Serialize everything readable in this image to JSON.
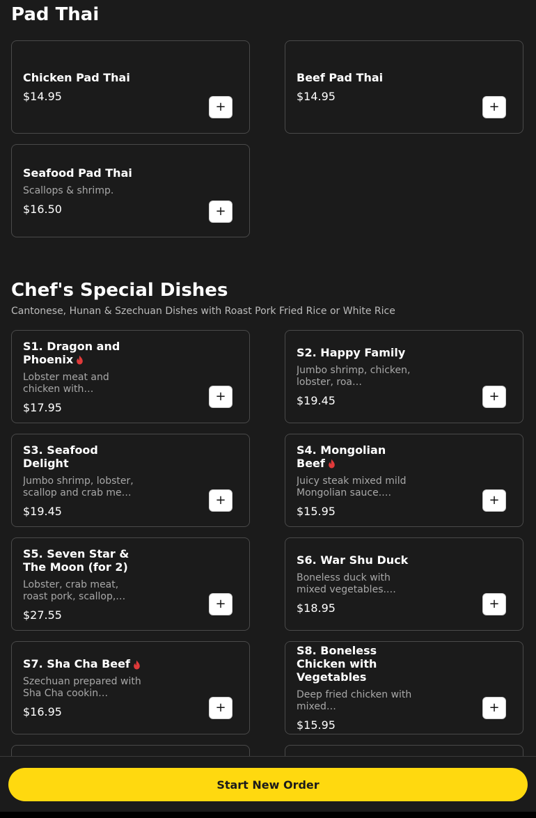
{
  "sections": [
    {
      "title": "Pad Thai",
      "items": [
        {
          "name": "Chicken Pad Thai",
          "price": "$14.95"
        },
        {
          "name": "Beef Pad Thai",
          "price": "$14.95"
        },
        {
          "name": "Seafood Pad Thai",
          "desc": "Scallops & shrimp.",
          "price": "$16.50"
        }
      ]
    },
    {
      "title": "Chef's Special Dishes",
      "subtitle": "Cantonese, Hunan & Szechuan Dishes with Roast Pork Fried Rice or White Rice",
      "items": [
        {
          "name": "S1. Dragon and Phoenix",
          "spicy": true,
          "desc": "Lobster meat and chicken with…",
          "price": "$17.95"
        },
        {
          "name": "S2. Happy Family",
          "desc": "Jumbo shrimp, chicken, lobster, roa…",
          "price": "$19.45"
        },
        {
          "name": "S3. Seafood Delight",
          "desc": "Jumbo shrimp, lobster, scallop and crab me…",
          "price": "$19.45"
        },
        {
          "name": "S4. Mongolian Beef",
          "spicy": true,
          "desc": "Juicy steak mixed mild Mongolian sauce.…",
          "price": "$15.95"
        },
        {
          "name": "S5. Seven Star & The Moon (for 2)",
          "desc": "Lobster, crab meat, roast pork, scallop,…",
          "price": "$27.55"
        },
        {
          "name": "S6. War Shu Duck",
          "desc": "Boneless duck with mixed vegetables.…",
          "price": "$18.95"
        },
        {
          "name": "S7. Sha Cha Beef",
          "spicy": true,
          "desc": "Szechuan prepared with Sha Cha cookin…",
          "price": "$16.95"
        },
        {
          "name": "S8. Boneless Chicken with Vegetables",
          "desc": "Deep fried chicken with mixed…",
          "price": "$15.95"
        }
      ]
    }
  ],
  "icons": {
    "add": "plus-icon",
    "spicy": "flame-icon"
  },
  "add_symbol": "+",
  "colors": {
    "background": "#1b1b1b",
    "accent": "#ffd90f",
    "spicy": "#e03a3a",
    "border": "#4a4a4a"
  },
  "footer": {
    "start_order_label": "Start New Order"
  }
}
